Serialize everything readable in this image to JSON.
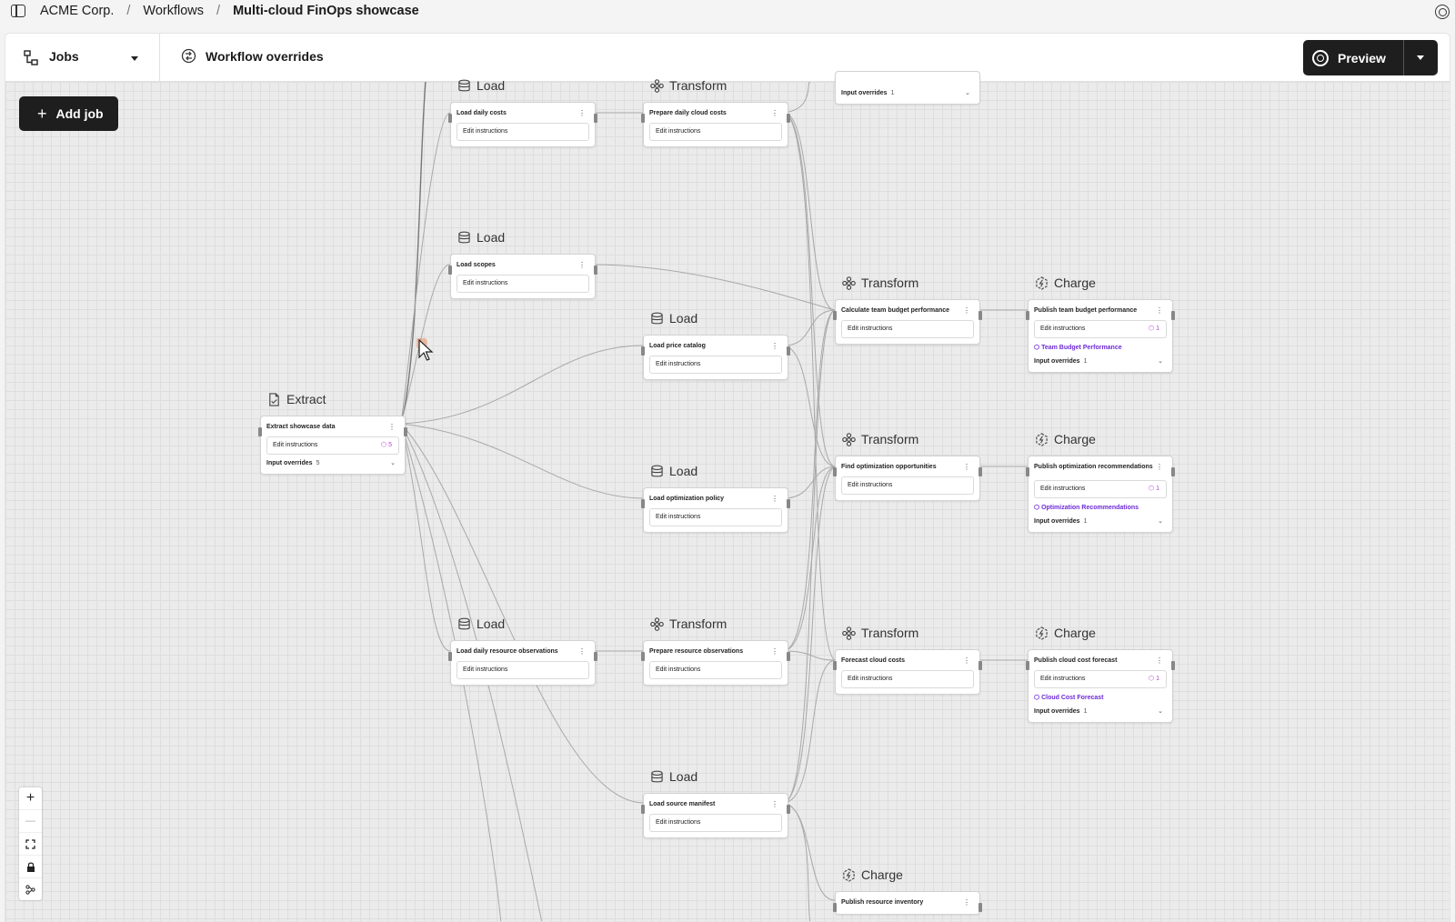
{
  "breadcrumb": {
    "org": "ACME Corp.",
    "workflows": "Workflows",
    "current": "Multi-cloud FinOps showcase",
    "sep": "/"
  },
  "toolbar": {
    "jobs_label": "Jobs",
    "overrides_label": "Workflow overrides",
    "preview_label": "Preview"
  },
  "canvas": {
    "add_job_label": "Add job",
    "zoom_in": "+",
    "zoom_out": "—"
  },
  "common": {
    "edit_instructions": "Edit instructions",
    "input_overrides": "Input overrides",
    "menu_dots": "⋮",
    "chevron": "⌄"
  },
  "nodes": {
    "overrides_top": {
      "overrides_count": "1"
    },
    "load_daily_costs": {
      "kind": "Load",
      "title": "Load daily costs"
    },
    "prepare_daily_cloud_costs": {
      "kind": "Transform",
      "title": "Prepare daily cloud costs"
    },
    "load_scopes": {
      "kind": "Load",
      "title": "Load scopes"
    },
    "calc_team_budget": {
      "kind": "Transform",
      "title": "Calculate team budget performance"
    },
    "publish_team_budget": {
      "kind": "Charge",
      "title": "Publish team budget performance",
      "badge": "1",
      "output": "Team Budget Performance",
      "overrides_count": "1"
    },
    "load_price_catalog": {
      "kind": "Load",
      "title": "Load price catalog"
    },
    "extract_showcase": {
      "kind": "Extract",
      "title": "Extract showcase data",
      "badge": "5",
      "overrides_count": "5"
    },
    "find_opt": {
      "kind": "Transform",
      "title": "Find optimization opportunities"
    },
    "publish_opt": {
      "kind": "Charge",
      "title": "Publish optimization recommendations",
      "badge": "1",
      "output": "Optimization Recommendations",
      "overrides_count": "1"
    },
    "load_opt_policy": {
      "kind": "Load",
      "title": "Load optimization policy"
    },
    "load_resource_obs": {
      "kind": "Load",
      "title": "Load daily resource observations"
    },
    "prepare_resource_obs": {
      "kind": "Transform",
      "title": "Prepare resource observations"
    },
    "forecast_costs": {
      "kind": "Transform",
      "title": "Forecast cloud costs"
    },
    "publish_forecast": {
      "kind": "Charge",
      "title": "Publish cloud cost forecast",
      "badge": "1",
      "output": "Cloud Cost Forecast",
      "overrides_count": "1"
    },
    "load_source_manifest": {
      "kind": "Load",
      "title": "Load source manifest"
    },
    "publish_inventory": {
      "kind": "Charge",
      "title": "Publish resource inventory"
    }
  },
  "colors": {
    "accent_output": "#6d2bd8",
    "badge": "#b13fd0",
    "button_dark": "#1e1e1e",
    "edge": "#a9a9a9"
  },
  "icons": {
    "load": "database-icon",
    "transform": "flower-icon",
    "charge": "hexagon-bolt-icon",
    "extract": "document-icon"
  }
}
